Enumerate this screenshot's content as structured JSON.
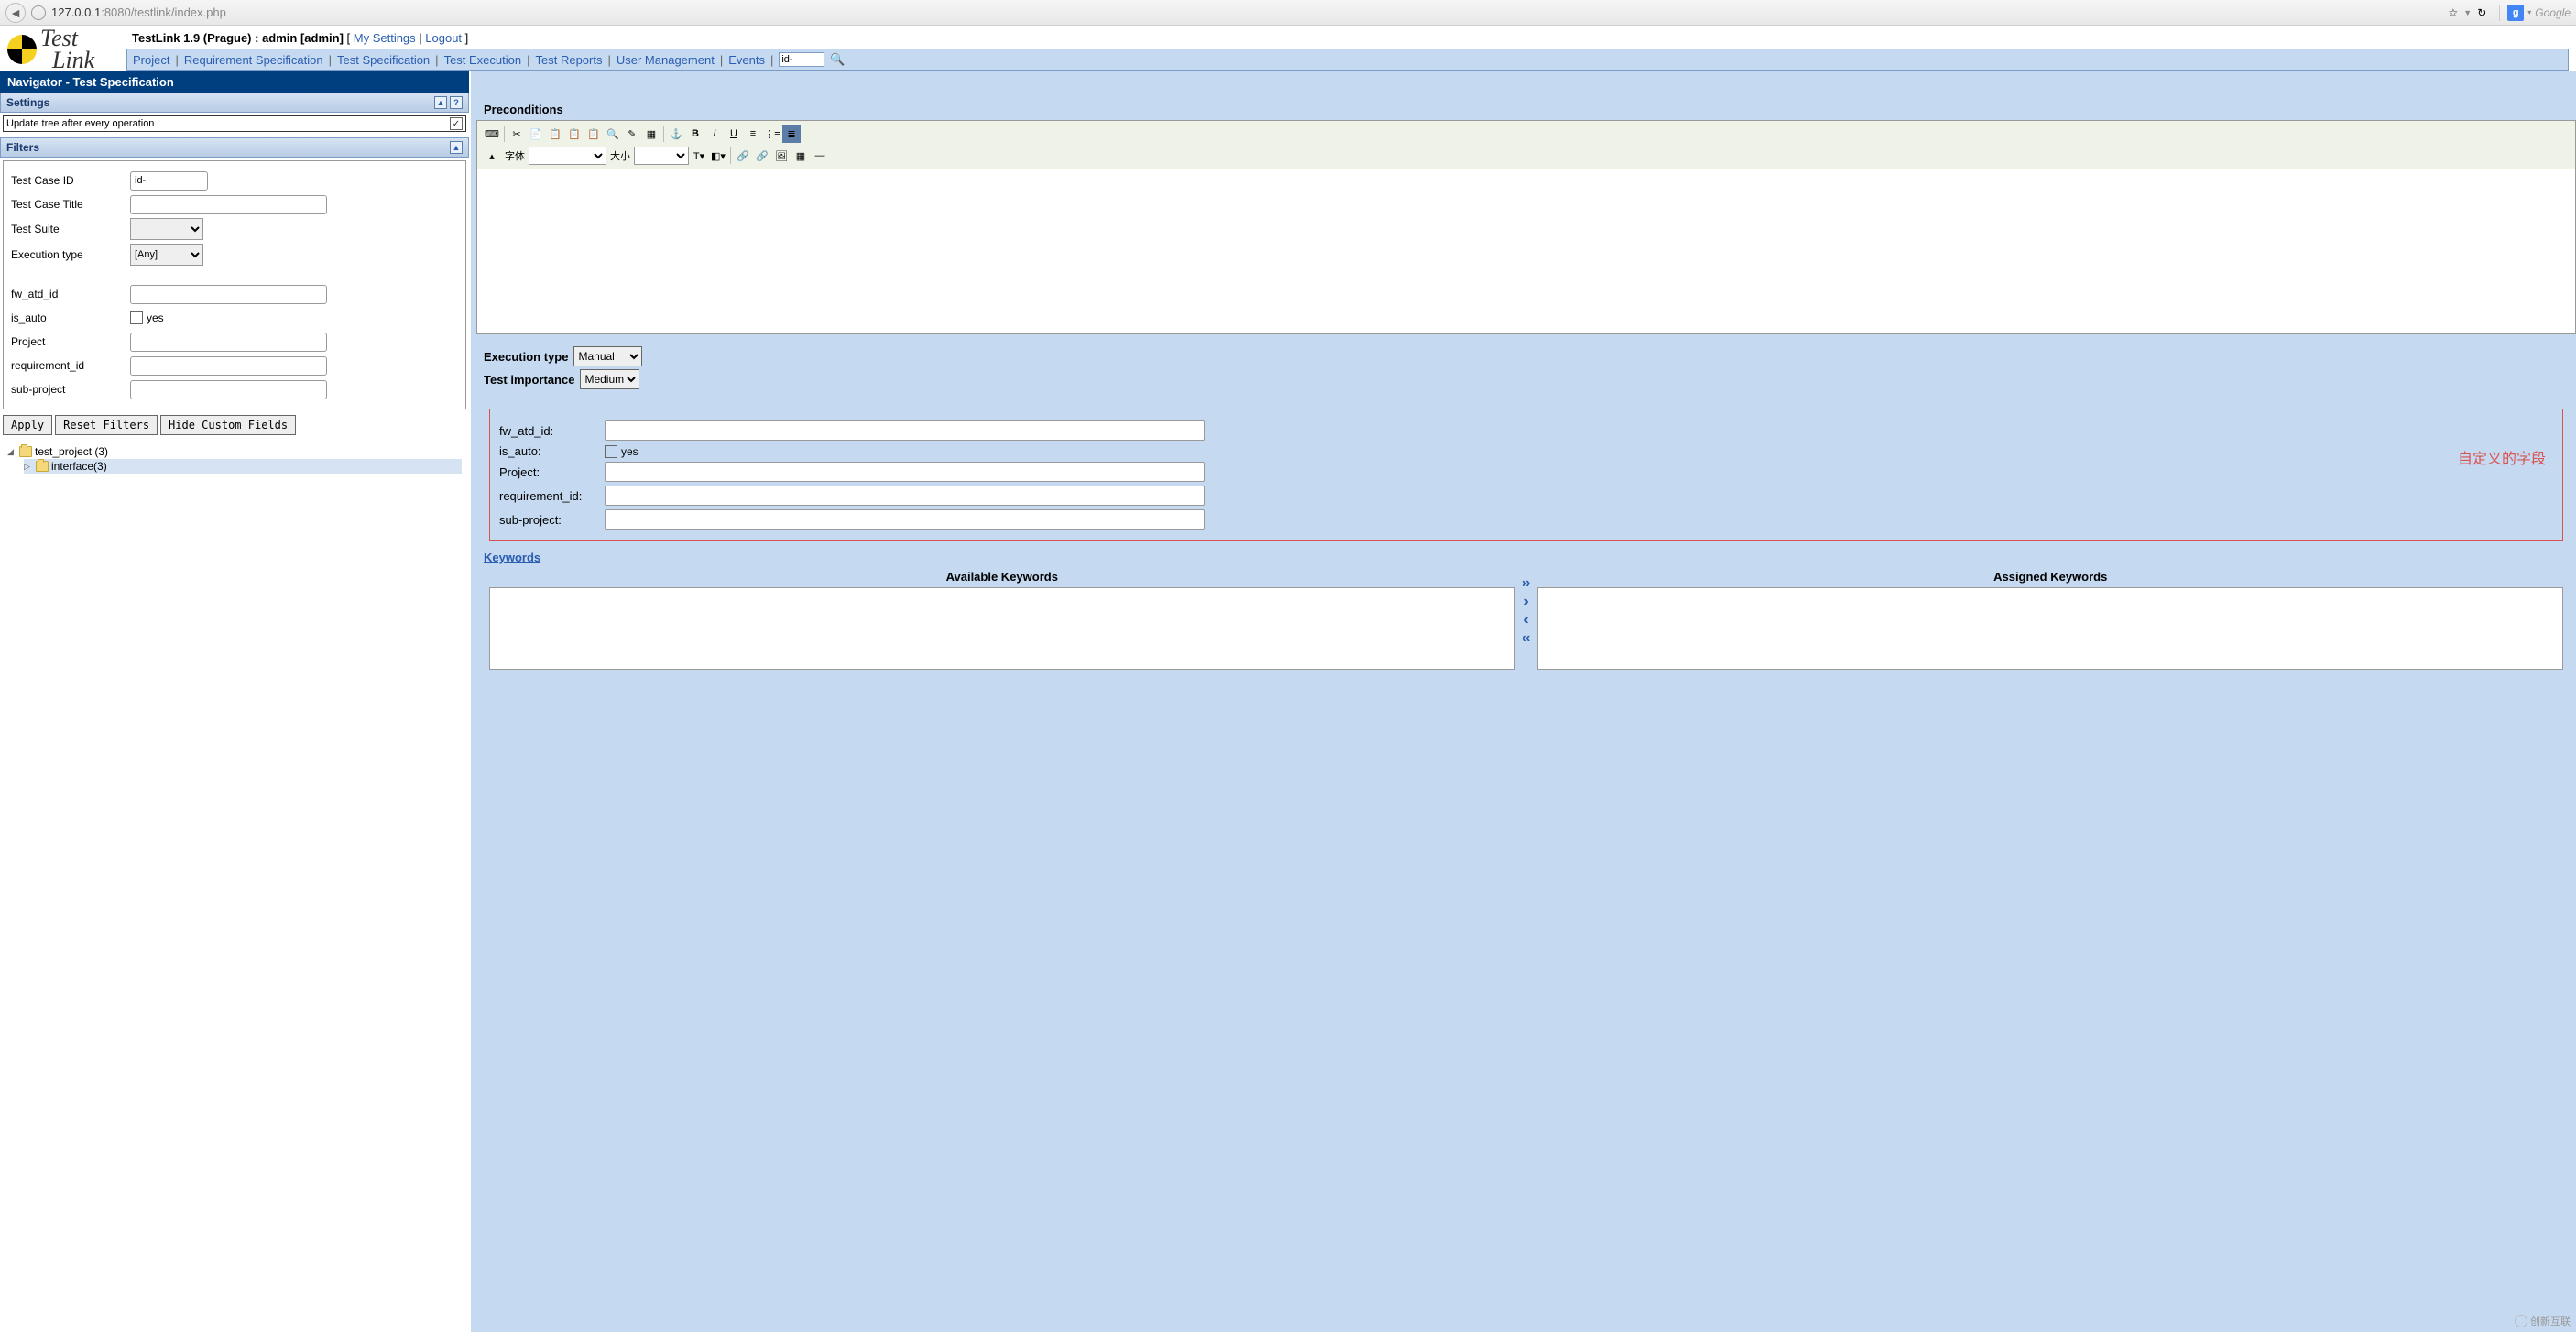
{
  "browser": {
    "url_host": "127.0.0.1",
    "url_port": ":8080",
    "url_path": "/testlink/index.php",
    "search_placeholder": "Google"
  },
  "header": {
    "app_title": "TestLink 1.9 (Prague) : admin [admin] ",
    "my_settings": "My Settings",
    "logout": "Logout",
    "nav": {
      "project": "Project",
      "req_spec": "Requirement Specification",
      "test_spec": "Test Specification",
      "test_exec": "Test Execution",
      "test_reports": "Test Reports",
      "user_mgmt": "User Management",
      "events": "Events"
    },
    "search_value": "id-"
  },
  "left": {
    "nav_title": "Navigator - Test Specification",
    "settings_hd": "Settings",
    "settings_option": "Update tree after every operation",
    "filters_hd": "Filters",
    "filters": {
      "tc_id_label": "Test Case ID",
      "tc_id_value": "id-",
      "tc_title_label": "Test Case Title",
      "ts_label": "Test Suite",
      "exec_type_label": "Execution type",
      "exec_type_value": "[Any]",
      "fw_atd_id_label": "fw_atd_id",
      "is_auto_label": "is_auto",
      "is_auto_opt": "yes",
      "project_label": "Project",
      "req_id_label": "requirement_id",
      "sub_project_label": "sub-project"
    },
    "buttons": {
      "apply": "Apply",
      "reset": "Reset Filters",
      "hide": "Hide Custom Fields"
    },
    "tree": {
      "root": "test_project (3)",
      "child": "interface(3)"
    }
  },
  "right": {
    "preconditions": "Preconditions",
    "toolbar": {
      "font_label": "字体",
      "size_label": "大小"
    },
    "exec_type_label": "Execution type",
    "exec_type_value": "Manual",
    "importance_label": "Test importance",
    "importance_value": "Medium",
    "custom": {
      "fw_atd_id": "fw_atd_id:",
      "is_auto": "is_auto:",
      "is_auto_opt": "yes",
      "project": "Project:",
      "req_id": "requirement_id:",
      "sub_project": "sub-project:",
      "annotation": "自定义的字段"
    },
    "keywords_hd": "Keywords",
    "available_kw": "Available Keywords",
    "assigned_kw": "Assigned Keywords"
  },
  "watermark": "创新互联"
}
